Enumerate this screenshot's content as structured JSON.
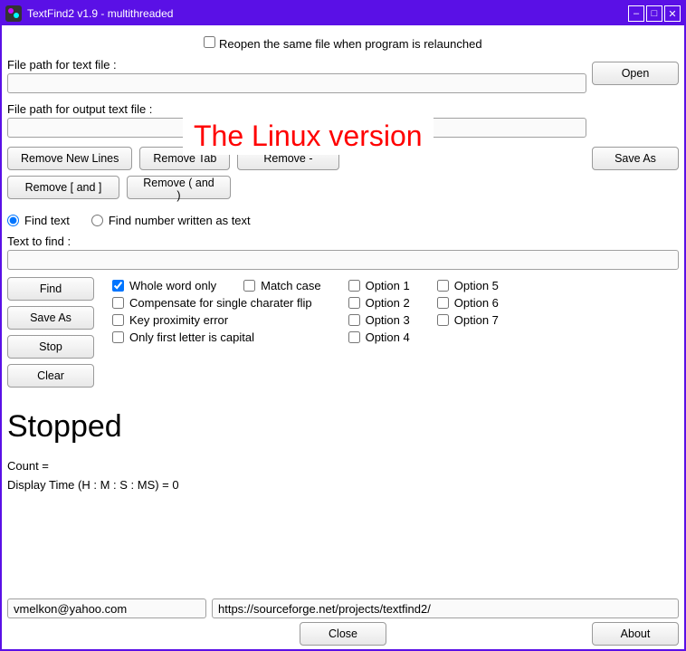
{
  "window": {
    "title": "TextFind2 v1.9 - multithreaded"
  },
  "checkboxes": {
    "reopen": "Reopen the same file when program is relaunched"
  },
  "labels": {
    "filepath_text": "File path for text file :",
    "filepath_output": "File path for output text file :",
    "text_to_find": "Text to find :"
  },
  "banner": "The Linux version",
  "buttons": {
    "open": "Open",
    "remove_newlines": "Remove New Lines",
    "remove_tab": "Remove Tab",
    "remove_dash": "Remove -",
    "save_as": "Save As",
    "remove_brackets": "Remove [ and ]",
    "remove_parens": "Remove ( and )",
    "find": "Find",
    "save_as2": "Save As",
    "stop": "Stop",
    "clear": "Clear",
    "close": "Close",
    "about": "About"
  },
  "radios": {
    "find_text": "Find text",
    "find_number": "Find number written as text"
  },
  "options": {
    "col1": {
      "whole_word": "Whole word only",
      "compensate": "Compensate for single charater flip",
      "key_proximity": "Key proximity error",
      "first_capital": "Only first letter is capital",
      "match_case": "Match case"
    },
    "col2": {
      "o1": "Option 1",
      "o2": "Option 2",
      "o3": "Option 3",
      "o4": "Option 4"
    },
    "col3": {
      "o5": "Option 5",
      "o6": "Option 6",
      "o7": "Option 7"
    }
  },
  "status": {
    "heading": "Stopped",
    "count": "Count =",
    "display_time": "Display Time (H : M : S : MS) = 0"
  },
  "bottom": {
    "email": "vmelkon@yahoo.com",
    "url": "https://sourceforge.net/projects/textfind2/"
  },
  "inputs": {
    "filepath_text_val": "",
    "filepath_output_val": "",
    "text_to_find_val": ""
  }
}
